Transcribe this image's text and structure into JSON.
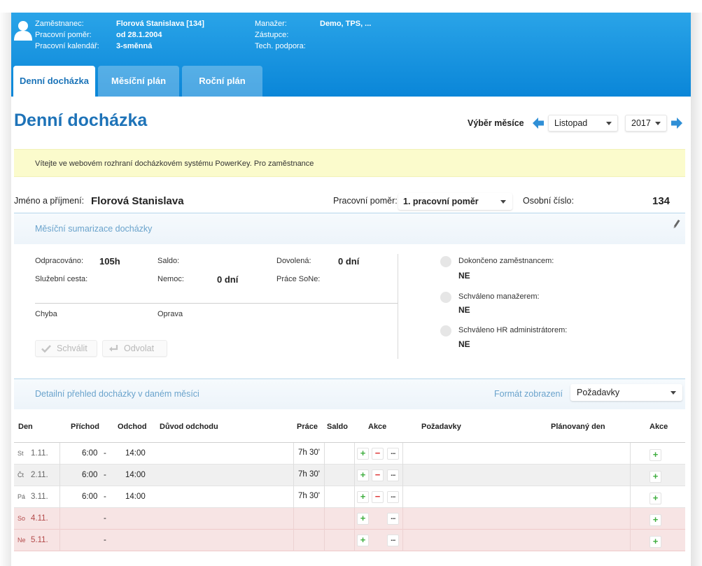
{
  "header": {
    "employee_label": "Zaměstnanec:",
    "employee_value": "Florová Stanislava [134]",
    "contract_label": "Pracovní poměr:",
    "contract_value": "od 28.1.2004",
    "calendar_label": "Pracovní kalendář:",
    "calendar_value": "3-směnná",
    "manager_label": "Manažer:",
    "manager_value": "Demo, TPS, ...",
    "deputy_label": "Zástupce:",
    "support_label": "Tech. podpora:"
  },
  "tabs": [
    {
      "label": "Denní docházka",
      "active": true
    },
    {
      "label": "Měsíční plán",
      "active": false
    },
    {
      "label": "Roční plán",
      "active": false
    }
  ],
  "page_title": "Denní docházka",
  "month_picker": {
    "label": "Výběr měsíce",
    "month": "Listopad",
    "year": "2017"
  },
  "notice": "Vítejte ve webovém rozhraní docházkovém systému PowerKey. Pro zaměstnance",
  "person": {
    "name_label": "Jméno a příjmení:",
    "name_value": "Florová Stanislava",
    "contract_label": "Pracovní poměr:",
    "contract_value": "1. pracovní poměr",
    "number_label": "Osobní číslo:",
    "number_value": "134"
  },
  "summary": {
    "title": "Měsíční sumarizace docházky",
    "worked_label": "Odpracováno:",
    "worked_value": "105h",
    "saldo_label": "Saldo:",
    "leave_label": "Dovolená:",
    "leave_value": "0 dní",
    "trip_label": "Služební cesta:",
    "sick_label": "Nemoc:",
    "sick_value": "0 dní",
    "weekend_label": "Práce SoNe:",
    "error_label": "Chyba",
    "fix_label": "Oprava",
    "approve_button": "Schválit",
    "revoke_button": "Odvolat",
    "statuses": [
      {
        "label": "Dokončeno zaměstnancem:",
        "value": "NE"
      },
      {
        "label": "Schváleno manažerem:",
        "value": "NE"
      },
      {
        "label": "Schváleno HR administrátorem:",
        "value": "NE"
      }
    ]
  },
  "detail": {
    "title": "Detailní přehled docházky v daném měsíci",
    "format_label": "Formát zobrazení",
    "format_value": "Požadavky",
    "columns": {
      "day": "Den",
      "arrival": "Příchod",
      "departure": "Odchod",
      "reason": "Důvod odchodu",
      "work": "Práce",
      "saldo": "Saldo",
      "actions": "Akce",
      "requests": "Požadavky",
      "planned": "Plánovaný den",
      "actions2": "Akce"
    },
    "rows": [
      {
        "dow": "St",
        "date": "1.11.",
        "arrival": "6:00",
        "sep": "-",
        "departure": "14:00",
        "work": "7h 30'",
        "weekend": false
      },
      {
        "dow": "Čt",
        "date": "2.11.",
        "arrival": "6:00",
        "sep": "-",
        "departure": "14:00",
        "work": "7h 30'",
        "weekend": false
      },
      {
        "dow": "Pá",
        "date": "3.11.",
        "arrival": "6:00",
        "sep": "-",
        "departure": "14:00",
        "work": "7h 30'",
        "weekend": false
      },
      {
        "dow": "So",
        "date": "4.11.",
        "arrival": "",
        "sep": "-",
        "departure": "",
        "work": "",
        "weekend": true
      },
      {
        "dow": "Ne",
        "date": "5.11.",
        "arrival": "",
        "sep": "-",
        "departure": "",
        "work": "",
        "weekend": true
      }
    ]
  },
  "icons": {
    "plus": "+",
    "minus": "−",
    "more": "...",
    "pencil": "pencil-icon",
    "check": "check-icon",
    "undo": "undo-icon"
  },
  "colors": {
    "header": "#0a86d8",
    "title": "#1e73b8",
    "notice": "#fbfbcc",
    "weekend_row": "#f7e4e4"
  }
}
